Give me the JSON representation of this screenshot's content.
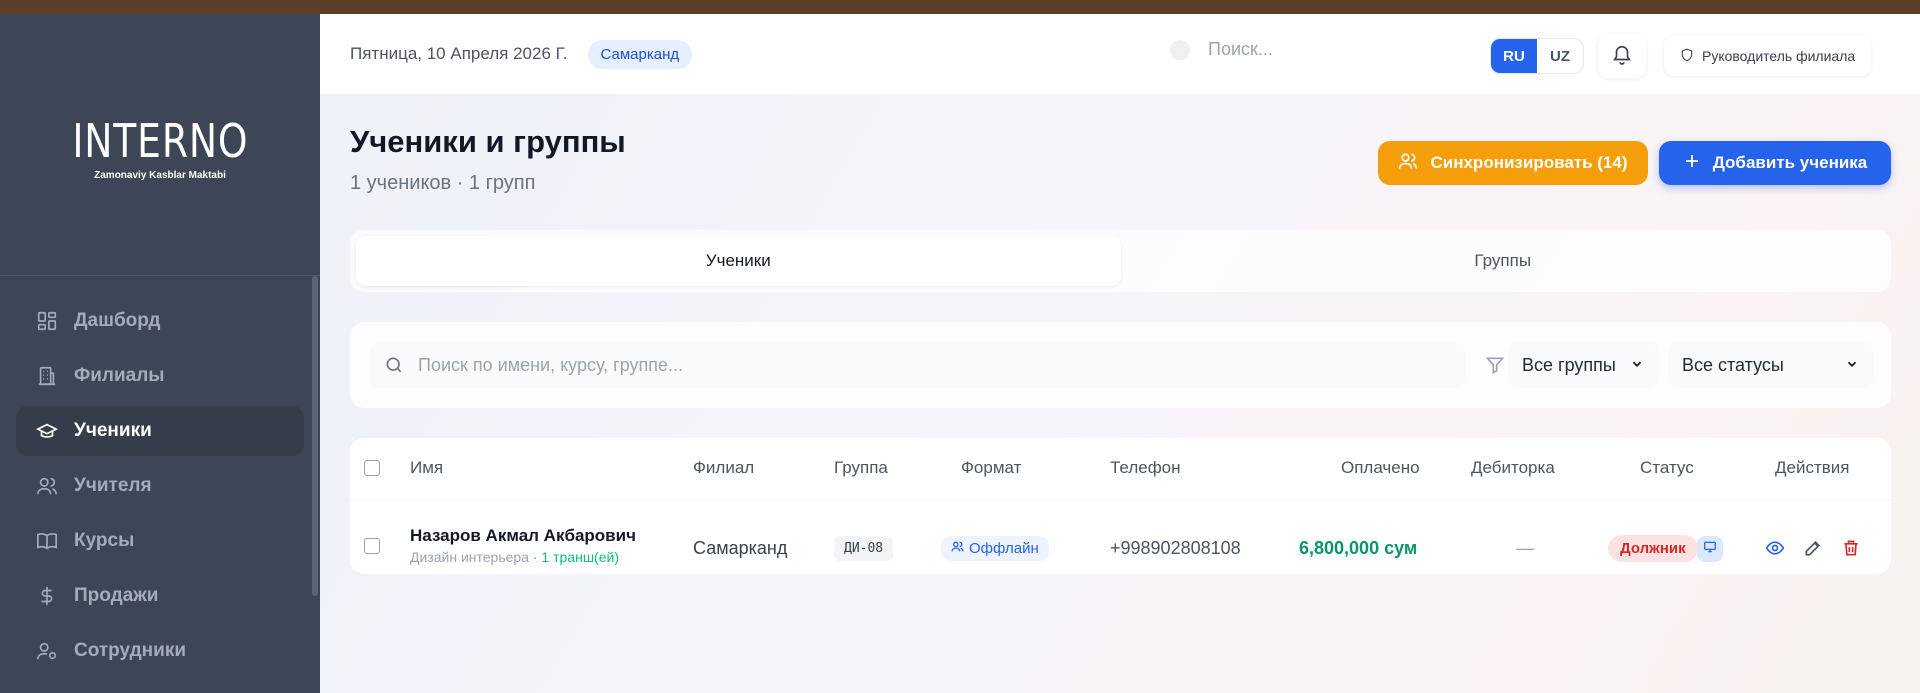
{
  "sidebar": {
    "logo": "INTERNO",
    "logo_sub": "Zamonaviy Kasblar Maktabi",
    "items": [
      {
        "label": "Дашборд",
        "icon": "dashboard-icon"
      },
      {
        "label": "Филиалы",
        "icon": "building-icon"
      },
      {
        "label": "Ученики",
        "icon": "graduation-cap-icon",
        "active": true
      },
      {
        "label": "Учителя",
        "icon": "users-icon"
      },
      {
        "label": "Курсы",
        "icon": "book-icon"
      },
      {
        "label": "Продажи",
        "icon": "dollar-icon"
      },
      {
        "label": "Сотрудники",
        "icon": "user-cog-icon"
      }
    ]
  },
  "header": {
    "date": "Пятница, 10 Апреля 2026 Г.",
    "branch": "Самарканд",
    "search_placeholder": "Поиск...",
    "lang_ru": "RU",
    "lang_uz": "UZ",
    "role": "Руководитель филиала"
  },
  "page": {
    "title": "Ученики и группы",
    "subtitle": "1 учеников · 1 групп",
    "sync_label": "Синхронизировать (14)",
    "add_label": "Добавить ученика"
  },
  "tabs": {
    "students": "Ученики",
    "groups": "Группы"
  },
  "filters": {
    "search_placeholder": "Поиск по имени, курсу, группе...",
    "groups": "Все группы",
    "statuses": "Все статусы"
  },
  "table": {
    "headers": {
      "name": "Имя",
      "branch": "Филиал",
      "group": "Группа",
      "format": "Формат",
      "phone": "Телефон",
      "paid": "Оплачено",
      "debt": "Дебиторка",
      "status": "Статус",
      "actions": "Действия"
    },
    "rows": [
      {
        "name": "Назаров Акмал Акбарович",
        "course": "Дизайн интерьера",
        "tranches": "· 1 транш(ей)",
        "branch": "Самарканд",
        "group": "ДИ-08",
        "format": "Оффлайн",
        "phone": "+998902808108",
        "paid": "6,800,000 сум",
        "debt": "—",
        "status": "Должник"
      }
    ]
  },
  "colors": {
    "accent": "#2563eb",
    "sync": "#f59e0b",
    "sidebar": "#3d4656",
    "paid": "#059669",
    "debtor": "#dc2626"
  }
}
